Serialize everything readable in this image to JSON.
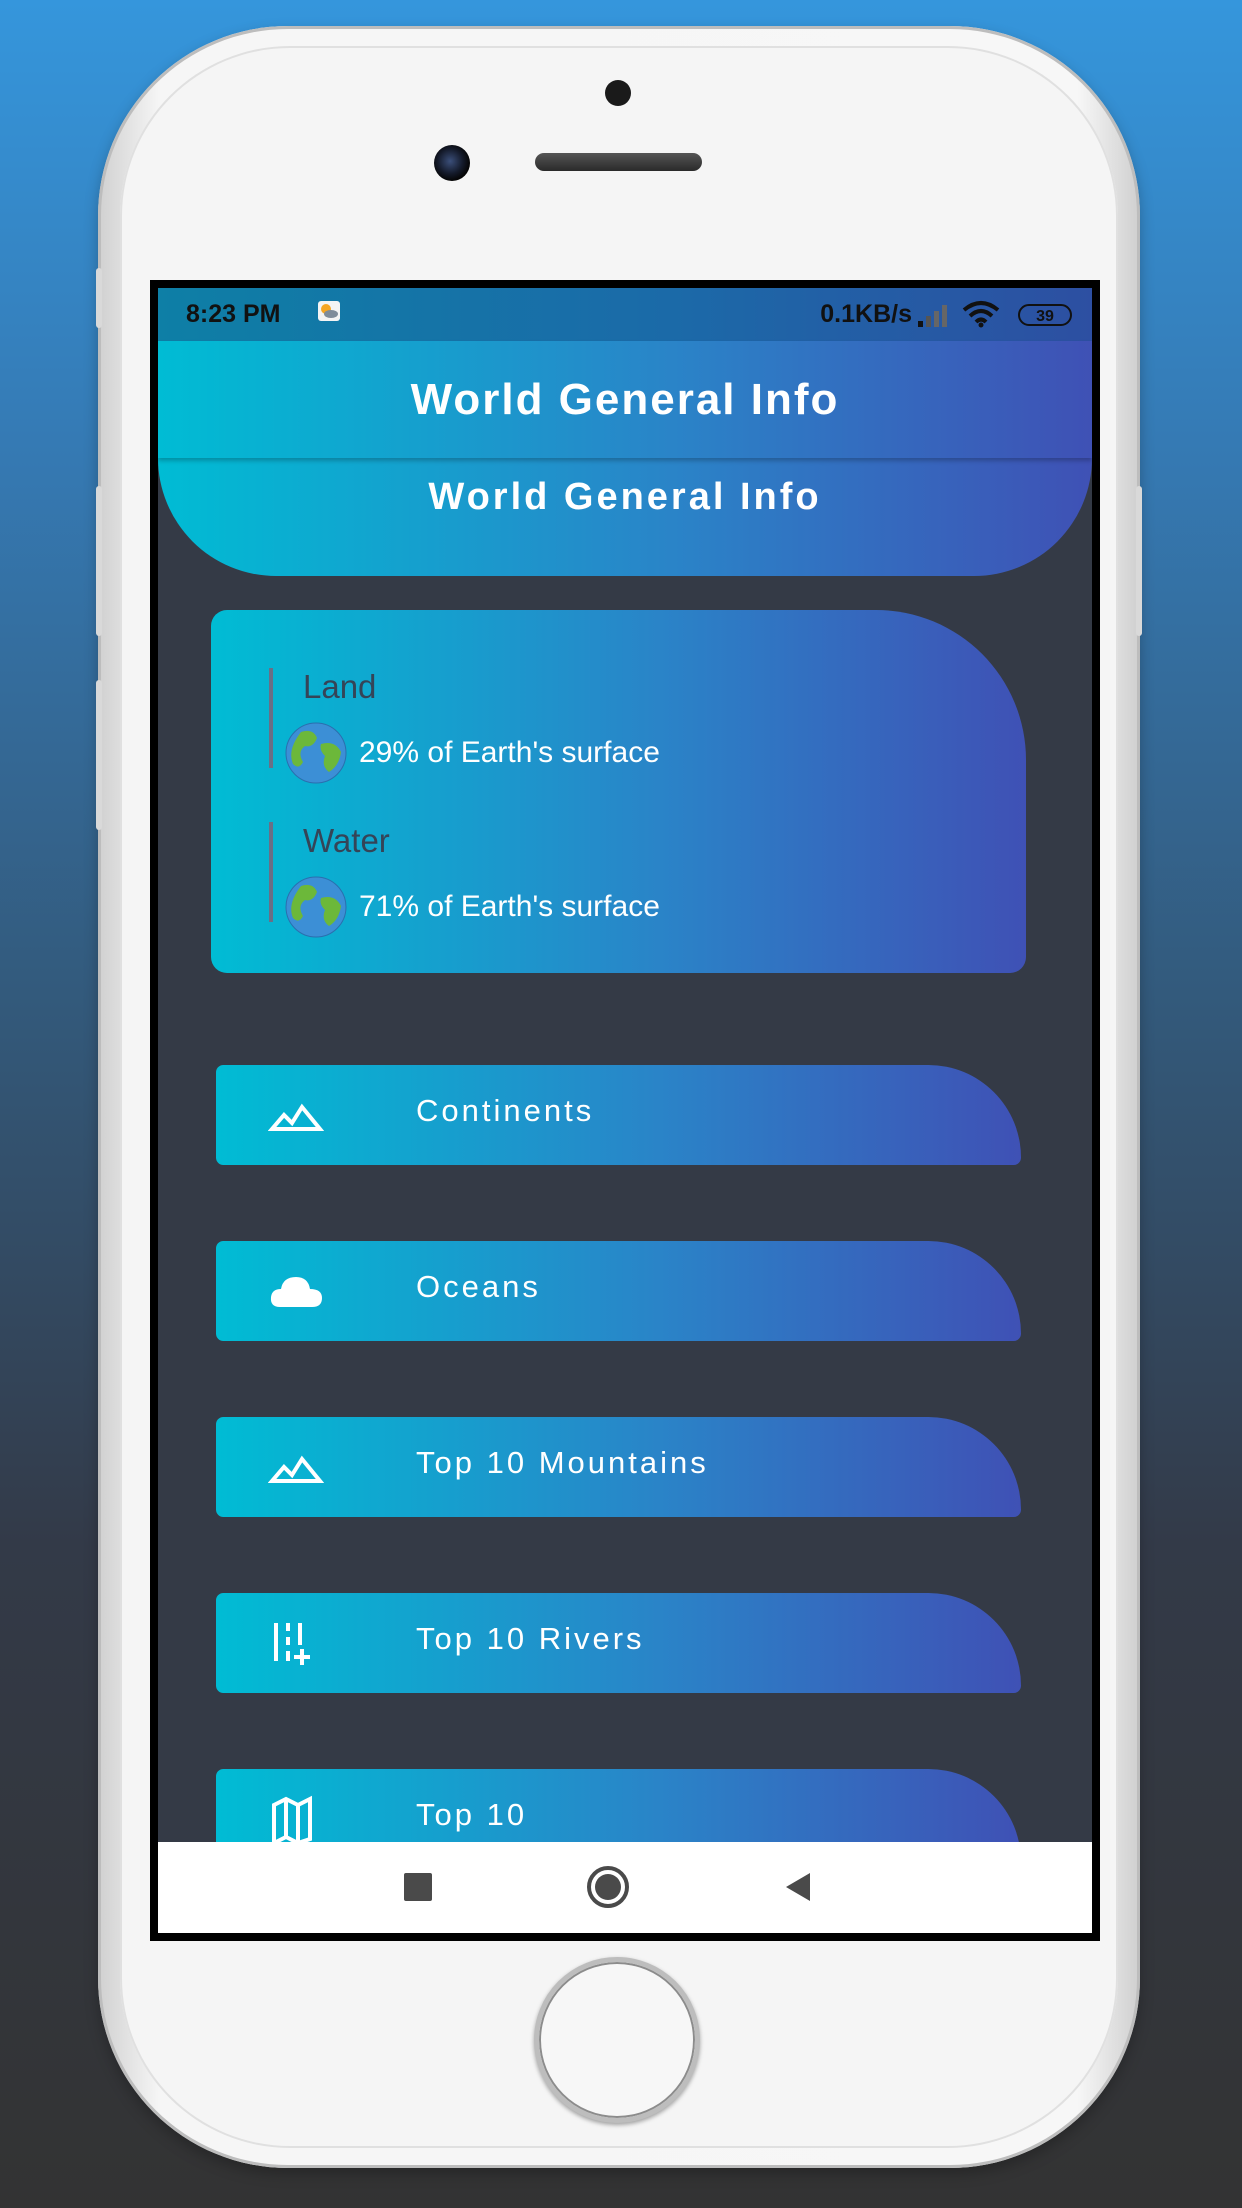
{
  "status_bar": {
    "time": "8:23 PM",
    "network_speed": "0.1KB/s",
    "battery": "39",
    "weather_icon": "weather-icon",
    "signal_icon": "signal-icon",
    "wifi_icon": "wifi-icon"
  },
  "app_bar": {
    "title": "World General Info"
  },
  "header": {
    "title": "World General Info"
  },
  "info_card": {
    "items": [
      {
        "title": "Land",
        "icon": "globe-icon",
        "text": "29% of Earth's surface"
      },
      {
        "title": "Water",
        "icon": "globe-icon",
        "text": "71% of Earth's surface"
      }
    ]
  },
  "menu": {
    "items": [
      {
        "label": "Continents",
        "icon": "mountain-icon"
      },
      {
        "label": "Oceans",
        "icon": "cloud-icon"
      },
      {
        "label": "Top 10 Mountains",
        "icon": "mountain-icon"
      },
      {
        "label": "Top 10 Rivers",
        "icon": "river-icon"
      },
      {
        "label": "Top 10",
        "icon": "map-icon"
      }
    ]
  },
  "nav_bar": {
    "recents": "square-icon",
    "home": "circle-icon",
    "back": "triangle-back-icon"
  },
  "colors": {
    "gradient_start": "#00bcd4",
    "gradient_end": "#3f51b5",
    "background": "#343a46",
    "info_title": "#354457"
  }
}
